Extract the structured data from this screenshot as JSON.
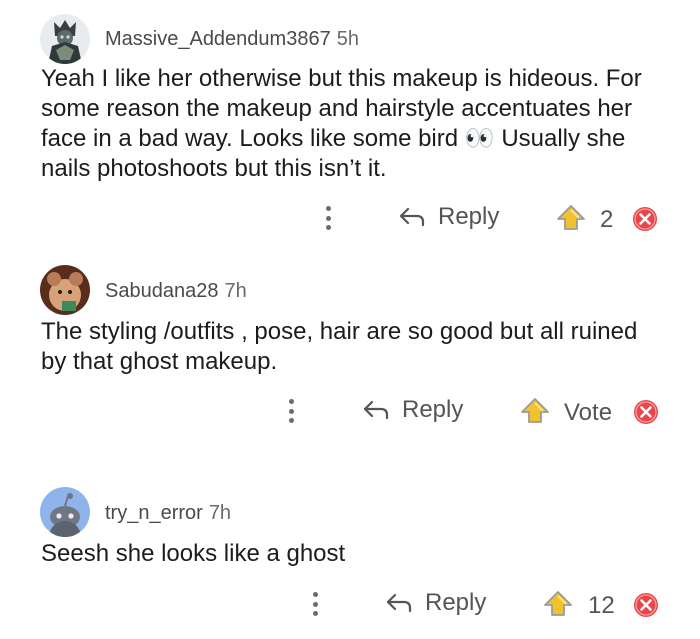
{
  "comments": [
    {
      "username": "Massive_Addendum3867",
      "time": "5h",
      "text": "Yeah I like her otherwise but this makeup is hideous. For some reason the makeup and hairstyle accentuates her face in a bad way. Looks like some bird 👀 Usually she nails photoshoots but this isn’t it.",
      "reply_label": "Reply",
      "vote_label": "2"
    },
    {
      "username": "Sabudana28",
      "time": "7h",
      "text": "The styling /outfits , pose, hair are so good but all ruined by that ghost makeup.",
      "reply_label": "Reply",
      "vote_label": "Vote"
    },
    {
      "username": "try_n_error",
      "time": "7h",
      "text": "Seesh she looks like a ghost",
      "reply_label": "Reply",
      "vote_label": "12"
    }
  ],
  "colors": {
    "upvote_fill": "#f2c12e",
    "upvote_stroke": "#9a9a9a",
    "downvote": "#e8464a",
    "text": "#1c1c1c",
    "muted": "#555555"
  },
  "icons": {
    "more": "kebab-icon",
    "reply": "reply-arrow-icon",
    "upvote": "upvote-icon",
    "downvote": "downvote-icon"
  }
}
